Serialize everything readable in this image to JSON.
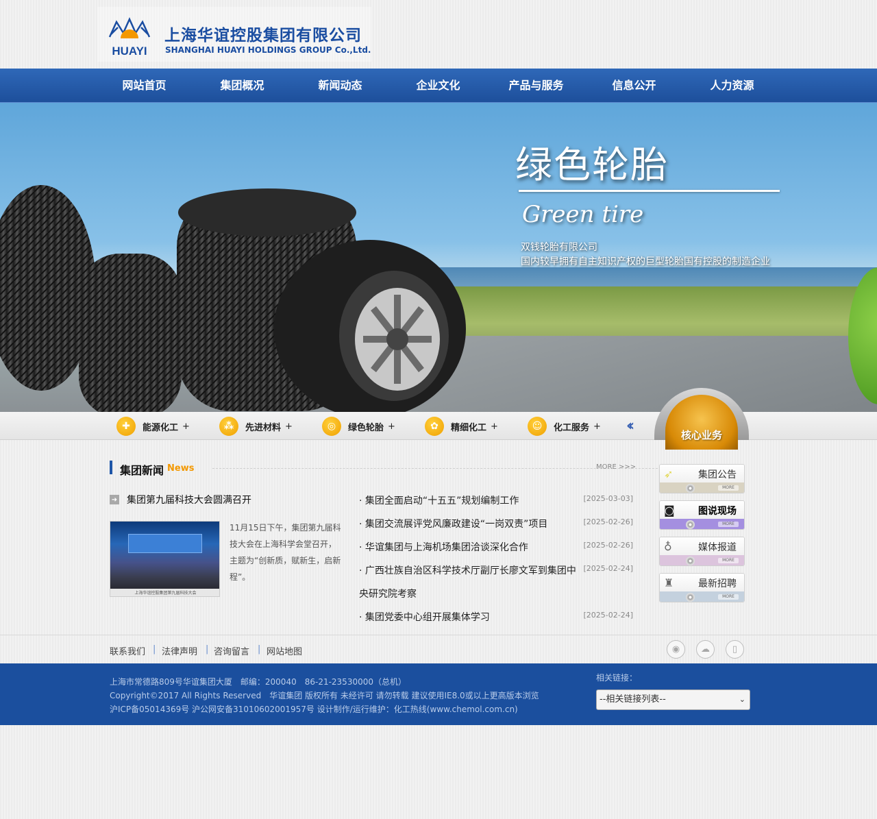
{
  "header": {
    "logo_cn": "上海华谊控股集团有限公司",
    "logo_en": "SHANGHAI HUAYI HOLDINGS GROUP Co.,Ltd.",
    "logo_mark": "HUAYI"
  },
  "nav": {
    "items": [
      "网站首页",
      "集团概况",
      "新闻动态",
      "企业文化",
      "产品与服务",
      "信息公开",
      "人力资源"
    ]
  },
  "banner": {
    "title": "绿色轮胎",
    "title_en": "Green tire",
    "line1": "双钱轮胎有限公司",
    "line2": "国内较早拥有自主知识产权的巨型轮胎国有控股的制造企业"
  },
  "business": {
    "items": [
      {
        "label": "能源化工",
        "icon": "plus-icon"
      },
      {
        "label": "先进材料",
        "icon": "molecule-icon"
      },
      {
        "label": "绿色轮胎",
        "icon": "tire-icon"
      },
      {
        "label": "精细化工",
        "icon": "flask-icon"
      },
      {
        "label": "化工服务",
        "icon": "service-icon"
      }
    ],
    "plus": "+",
    "core_label": "核心业务",
    "arrow": "«"
  },
  "news": {
    "title": "集团新闻",
    "title_en": "News",
    "more": "MORE >>>",
    "headline": "集团第九届科技大会圆满召开",
    "summary": "11月15日下午，集团第九届科技大会在上海科学会堂召开，主题为“创新质，赋新生，启新程”。",
    "photo_caption": "上海华谊控股集团第九届科技大会",
    "list": [
      {
        "title": "· 集团全面启动“十五五”规划编制工作",
        "date": "[2025-03-03]"
      },
      {
        "title": "· 集团交流展评党风廉政建设“一岗双责”项目",
        "date": "[2025-02-26]"
      },
      {
        "title": "· 华谊集团与上海机场集团洽谈深化合作",
        "date": "[2025-02-26]"
      },
      {
        "title": "· 广西壮族自治区科学技术厅副厅长廖文军到集团中央研究院考察",
        "date": "[2025-02-24]"
      },
      {
        "title": "· 集团党委中心组开展集体学习",
        "date": "[2025-02-24]"
      }
    ]
  },
  "side": {
    "items": [
      {
        "label": "集团公告",
        "icon": "bulletin-icon",
        "color": "#d9d3c2"
      },
      {
        "label": "图说现场",
        "icon": "camera-icon",
        "color": "#a48fe0"
      },
      {
        "label": "媒体报道",
        "icon": "microphone-icon",
        "color": "#dcc4dd"
      },
      {
        "label": "最新招聘",
        "icon": "chair-icon",
        "color": "#c4d1de"
      }
    ],
    "more": "MORE"
  },
  "footer_links": {
    "items": [
      "联系我们",
      "法律声明",
      "咨询留言",
      "网站地图"
    ],
    "separator": "|"
  },
  "footer": {
    "line1": "上海市常德路809号华谊集团大厦　邮编：200040　86-21-23530000（总机）",
    "line2": "Copyright©2017 All Rights Reserved　华谊集团 版权所有 未经许可 请勿转载 建议使用IE8.0或以上更高版本浏览",
    "line3": "沪ICP备05014369号 沪公网安备31010602001957号 设计制作/运行维护：化工热线(www.chemol.com.cn)",
    "related_label": "相关链接：",
    "related_select": "--相关链接列表--"
  }
}
